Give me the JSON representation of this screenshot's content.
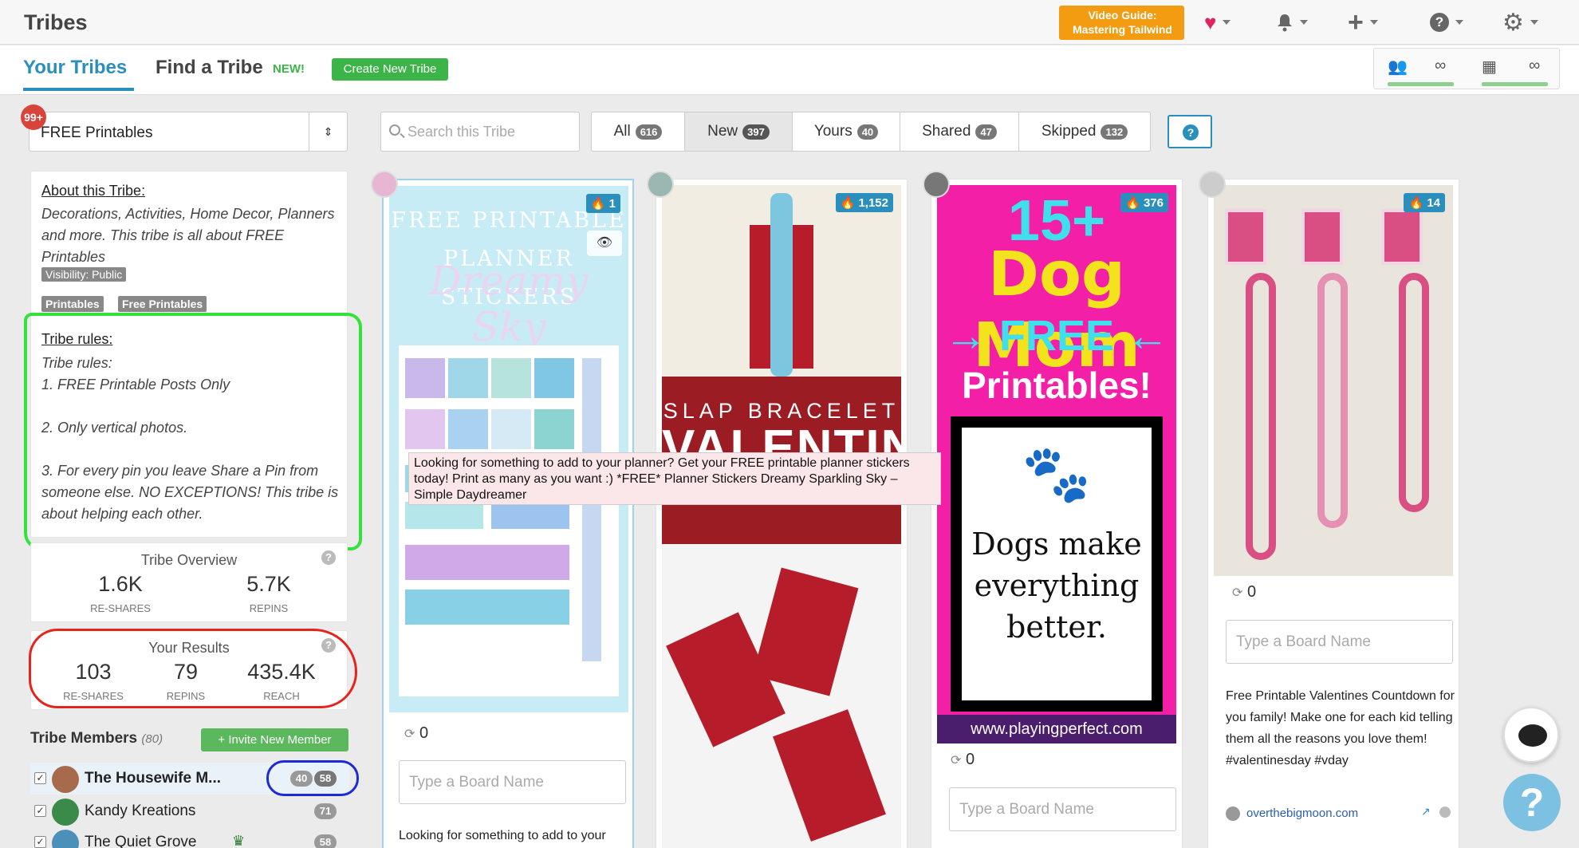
{
  "app": {
    "title": "Tribes",
    "video_guide": "Video Guide: Mastering Tailwind"
  },
  "tabs": {
    "your_tribes": "Your Tribes",
    "find_tribe": "Find a Tribe",
    "new_badge": "NEW!",
    "create_button": "Create New Tribe",
    "limit_icons": [
      "people-icon",
      "grid-plus-icon"
    ],
    "limit_values": [
      "∞",
      "∞"
    ]
  },
  "sidebar": {
    "notification_badge": "99+",
    "tribe_select": "FREE Printables",
    "about_title": "About this Tribe:",
    "about_desc": "Decorations, Activities, Home Decor, Planners and more. This tribe is all about FREE Printables",
    "visibility": "Visibility: Public",
    "tags": [
      "Printables",
      "Free Printables"
    ],
    "rules_title": "Tribe rules:",
    "rules_text": "Tribe rules:\n1. FREE Printable Posts Only\n\n2.  Only vertical photos.\n\n3. For every pin you leave Share a Pin from someone else. NO EXCEPTIONS! This tribe is about helping each other.",
    "overview": {
      "title": "Tribe Overview",
      "reshares": "1.6K",
      "reshares_label": "RE-SHARES",
      "repins": "5.7K",
      "repins_label": "REPINS"
    },
    "results": {
      "title": "Your Results",
      "reshares": "103",
      "reshares_label": "RE-SHARES",
      "repins": "79",
      "repins_label": "REPINS",
      "reach": "435.4K",
      "reach_label": "REACH"
    },
    "members_title": "Tribe Members",
    "members_count": "(80)",
    "invite_button": "+ Invite New Member",
    "members": [
      {
        "name": "The Housewife M...",
        "counts": [
          "40",
          "58"
        ]
      },
      {
        "name": "Kandy Kreations",
        "counts": [
          "71"
        ]
      },
      {
        "name": "The Quiet Grove",
        "counts": [
          "58"
        ]
      }
    ]
  },
  "filters": {
    "search_placeholder": "Search this Tribe",
    "items": [
      {
        "label": "All",
        "count": "616"
      },
      {
        "label": "New",
        "count": "397"
      },
      {
        "label": "Yours",
        "count": "40"
      },
      {
        "label": "Shared",
        "count": "47"
      },
      {
        "label": "Skipped",
        "count": "132"
      }
    ],
    "active": "New",
    "help": "?"
  },
  "pins": [
    {
      "repin_count": "1",
      "art_title": "FREE PRINTABLE PLANNER STICKERS",
      "art_script": "Dreamy Sky",
      "reshares": "0",
      "board_placeholder": "Type a Board Name",
      "description": "Looking for something to add to your"
    },
    {
      "repin_count": "1,152",
      "art_line1": "SLAP BRACELET",
      "art_line2": "VALENTINE"
    },
    {
      "repin_count": "376",
      "art_15": "15+",
      "art_dog": "Dog Mom",
      "art_free": "→ FREE ←",
      "art_print": "Printables!",
      "art_paw": "🐾",
      "art_words": "Dogs make everything better.",
      "art_url": "www.playingperfect.com",
      "reshares": "0",
      "board_placeholder": "Type a Board Name"
    },
    {
      "repin_count": "14",
      "reshares": "0",
      "board_placeholder": "Type a Board Name",
      "description": "Free Printable Valentines Countdown for you family! Make one for each kid telling them all the reasons you love them! #valentinesday #vday",
      "source": "overthebigmoon.com"
    }
  ],
  "tooltip": "Looking for something to add to your planner? Get your FREE printable planner stickers today! Print as many as you want :)   *FREE* Planner Stickers Dreamy Sparkling Sky – Simple Daydreamer",
  "colors": {
    "accent": "#2a8fbd",
    "green": "#3cb548",
    "orange": "#f39c12",
    "annotation_green": "#36e13b",
    "annotation_red": "#e8231b",
    "annotation_blue": "#1d2ad6"
  }
}
